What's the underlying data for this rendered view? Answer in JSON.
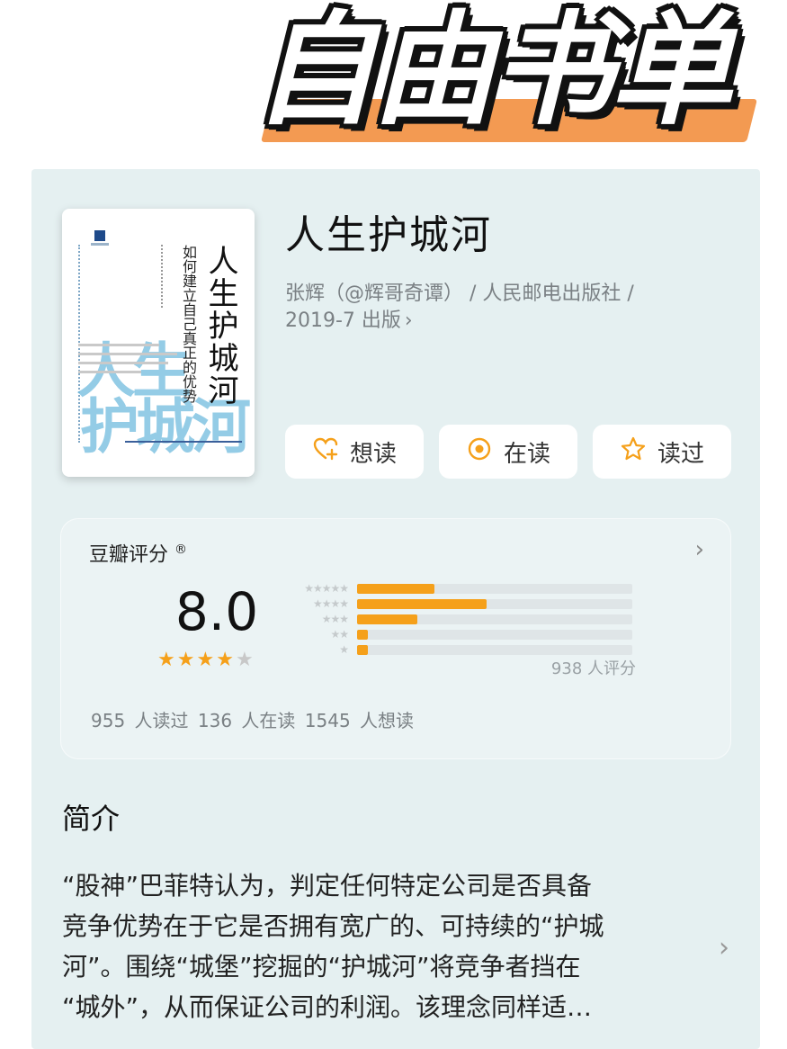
{
  "banner": {
    "title": "自由书单",
    "highlight_color": "#f39a52"
  },
  "book": {
    "title": "人生护城河",
    "meta_line1": "张辉（@辉哥奇谭） / 人民邮电出版社 /",
    "meta_line2": "2019-7 出版",
    "cover": {
      "title": "人生护城河",
      "subtitle": "如何建立自己真正的优势",
      "big_text_line1": "人生",
      "big_text_line2": "护城河",
      "big_text_color": "#70bbde"
    }
  },
  "actions": [
    {
      "label": "想读",
      "icon": "heart-plus-icon"
    },
    {
      "label": "在读",
      "icon": "target-circle-icon"
    },
    {
      "label": "读过",
      "icon": "star-outline-icon"
    }
  ],
  "rating": {
    "label": "豆瓣评分",
    "mark": "®",
    "score": "8.0",
    "stars_filled": 4,
    "stars_total": 5,
    "distribution": [
      {
        "stars": 5,
        "percent": 28
      },
      {
        "stars": 4,
        "percent": 47
      },
      {
        "stars": 3,
        "percent": 22
      },
      {
        "stars": 2,
        "percent": 4
      },
      {
        "stars": 1,
        "percent": 4
      }
    ],
    "count_text": "938 人评分",
    "stats": "955 人读过   136 人在读   1545 人想读",
    "accent_color": "#f5a01a"
  },
  "intro": {
    "heading": "简介",
    "lines": [
      "“股神”巴菲特认为，判定任何特定公司是否具备",
      "竞争优势在于它是否拥有宽广的、可持续的“护城",
      "河”。围绕“城堡”挖掘的“护城河”将竞争者挡在",
      "“城外”，从而保证公司的利润。该理念同样适…"
    ]
  },
  "colors": {
    "card_bg": "#e5f0f1",
    "panel_bg": "#ebf3f4"
  }
}
